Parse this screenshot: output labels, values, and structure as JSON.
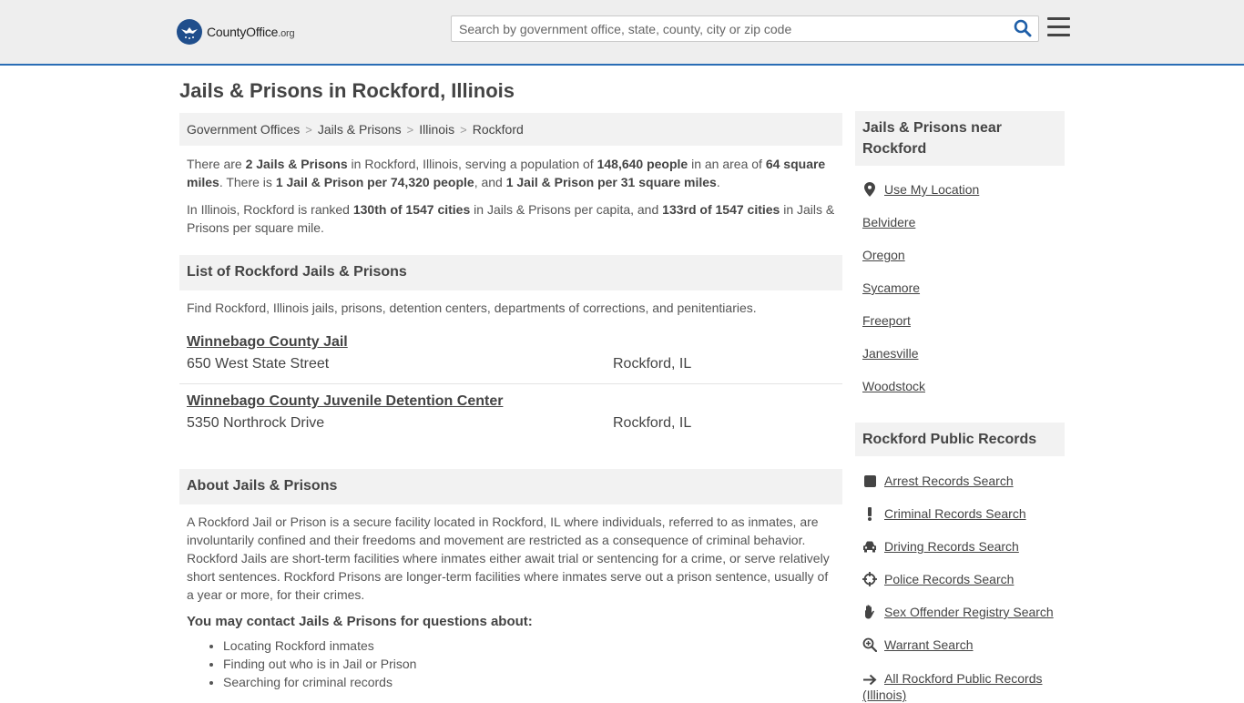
{
  "header": {
    "logo_main": "CountyOffice",
    "logo_tld": ".org",
    "search_placeholder": "Search by government office, state, county, city or zip code"
  },
  "page": {
    "title": "Jails & Prisons in Rockford, Illinois"
  },
  "breadcrumb": [
    "Government Offices",
    "Jails & Prisons",
    "Illinois",
    "Rockford"
  ],
  "intro": {
    "p1": {
      "t1": "There are ",
      "b1": "2 Jails & Prisons",
      "t2": " in Rockford, Illinois, serving a population of ",
      "b2": "148,640 people",
      "t3": " in an area of ",
      "b3": "64 square miles",
      "t4": ". There is ",
      "b4": "1 Jail & Prison per 74,320 people",
      "t5": ", and ",
      "b5": "1 Jail & Prison per 31 square miles",
      "t6": "."
    },
    "p2": {
      "t1": "In Illinois, Rockford is ranked ",
      "b1": "130th of 1547 cities",
      "t2": " in Jails & Prisons per capita, and ",
      "b2": "133rd of 1547 cities",
      "t3": " in Jails & Prisons per square mile."
    }
  },
  "list": {
    "heading": "List of Rockford Jails & Prisons",
    "description": "Find Rockford, Illinois jails, prisons, detention centers, departments of corrections, and penitentiaries.",
    "items": [
      {
        "name": "Winnebago County Jail",
        "address": "650 West State Street",
        "city": "Rockford, IL"
      },
      {
        "name": "Winnebago County Juvenile Detention Center",
        "address": "5350 Northrock Drive",
        "city": "Rockford, IL"
      }
    ]
  },
  "about": {
    "heading": "About Jails & Prisons",
    "body": "A Rockford Jail or Prison is a secure facility located in Rockford, IL where individuals, referred to as inmates, are involuntarily confined and their freedoms and movement are restricted as a consequence of criminal behavior. Rockford Jails are short-term facilities where inmates either await trial or sentencing for a crime, or serve relatively short sentences. Rockford Prisons are longer-term facilities where inmates serve out a prison sentence, usually of a year or more, for their crimes.",
    "contact_heading": "You may contact Jails & Prisons for questions about:",
    "bullets": [
      "Locating Rockford inmates",
      "Finding out who is in Jail or Prison",
      "Searching for criminal records"
    ]
  },
  "sidebar": {
    "nearby": {
      "heading": "Jails & Prisons near Rockford",
      "use_location": "Use My Location",
      "cities": [
        "Belvidere",
        "Oregon",
        "Sycamore",
        "Freeport",
        "Janesville",
        "Woodstock"
      ]
    },
    "records": {
      "heading": "Rockford Public Records",
      "items": [
        {
          "label": "Arrest Records Search",
          "icon": "square-icon"
        },
        {
          "label": "Criminal Records Search",
          "icon": "exclamation-icon"
        },
        {
          "label": "Driving Records Search",
          "icon": "car-icon"
        },
        {
          "label": "Police Records Search",
          "icon": "crosshair-icon"
        },
        {
          "label": "Sex Offender Registry Search",
          "icon": "hand-icon"
        },
        {
          "label": "Warrant Search",
          "icon": "magnify-icon"
        }
      ],
      "all_label": "All Rockford Public Records",
      "all_sub": "(Illinois)"
    }
  }
}
